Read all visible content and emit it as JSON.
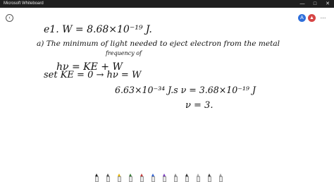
{
  "window": {
    "title": "Microsoft Whiteboard",
    "minimize_glyph": "—",
    "maximize_glyph": "□",
    "close_glyph": "✕"
  },
  "toolbar": {
    "back_icon": "‹",
    "user_initial": "A",
    "share_icon": "▲",
    "more_icon": "⋯"
  },
  "ink": {
    "line1": "e1. W = 8.68×10⁻¹⁹ J.",
    "line2a": "a) The minimum of light needed to eject electron from the metal",
    "line2b": "frequency of",
    "line3": "hν = KE + W",
    "line4": "set KE = 0 → hν = W",
    "line5": "6.63×10⁻³⁴ J.s ν = 3.68×10⁻¹⁹ J",
    "line6": "ν = 3."
  },
  "pen_tray": {
    "pens": [
      "#222222",
      "#4a4a4a",
      "#e0b000",
      "#3a7d3a",
      "#c23b3b",
      "#2f5fcf",
      "#7a3dbb",
      "#888888",
      "#333333",
      "#aaaaaa",
      "#444444",
      "#999999"
    ]
  }
}
